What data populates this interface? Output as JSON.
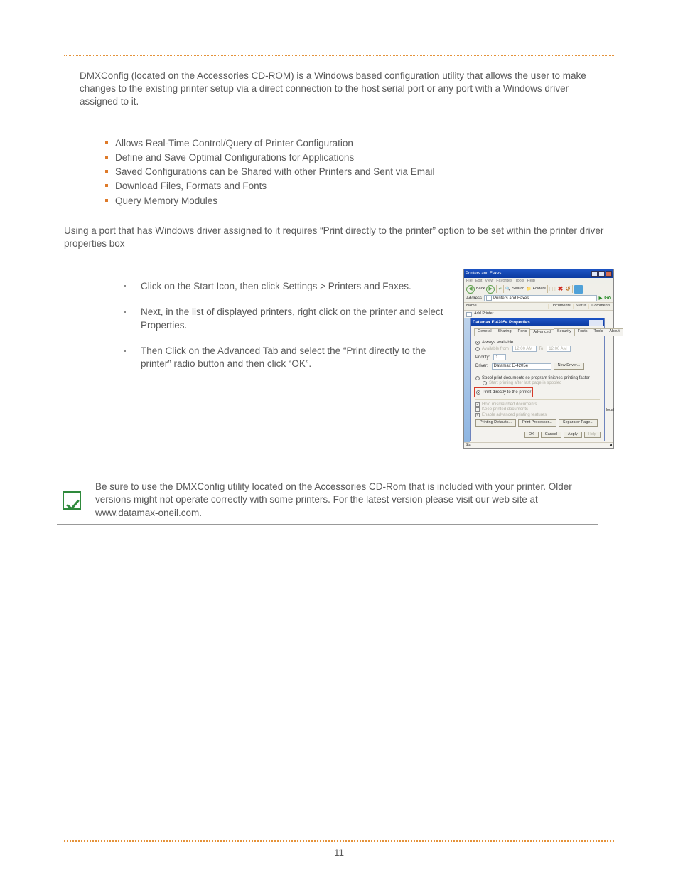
{
  "intro": "DMXConfig (located on the Accessories CD-ROM) is a Windows based configuration utility that allows the user to make changes to the existing printer setup via a direct connection to the host serial port or any port with a Windows driver assigned to it.",
  "features": [
    "Allows Real-Time Control/Query of Printer Configuration",
    "Define and Save Optimal Configurations for Applications",
    "Saved Configurations can be Shared with other Printers and Sent via Email",
    "Download Files, Formats and Fonts",
    "Query Memory Modules"
  ],
  "mid": "Using a port that has Windows driver assigned to it requires “Print directly to the printer” option to be set within the printer driver properties box",
  "steps": [
    "Click on the Start Icon, then click Settings > Printers and Faxes.",
    "Next, in the list of displayed printers, right click on the printer and select Properties.",
    "Then Click on the Advanced Tab and select the “Print directly to the printer” radio button and then click “OK”."
  ],
  "note": "Be sure to use the DMXConfig utility located on the Accessories CD-Rom that is included with your printer. Older versions might not operate correctly with some printers. For the latest version please visit our web site at www.datamax-oneil.com.",
  "page_number": "11",
  "mock": {
    "window_title": "Printers and Faxes",
    "menus": [
      "File",
      "Edit",
      "View",
      "Favorites",
      "Tools",
      "Help"
    ],
    "toolbar": {
      "back": "Back",
      "search": "Search",
      "folders": "Folders"
    },
    "address_label": "Address",
    "address_value": "Printers and Faxes",
    "go": "Go",
    "cols": {
      "name": "Name",
      "documents": "Documents",
      "status": "Status",
      "comments": "Comments"
    },
    "row1": "Add Printer",
    "rside": "nnect to local",
    "dialog": {
      "title": "Datamax E-4205e Properties",
      "tabs": [
        "General",
        "Sharing",
        "Ports",
        "Advanced",
        "Security",
        "Fonts",
        "Tools",
        "About"
      ],
      "always": "Always available",
      "avail_from": "Available from",
      "t1": "12:00 AM",
      "to": "To",
      "t2": "12:00 AM",
      "priority": "Priority:",
      "priority_v": "1",
      "driver": "Driver:",
      "driver_v": "Datamax E-4205e",
      "new_driver": "New Driver...",
      "spool": "Spool print documents so program finishes printing faster",
      "spool_sub": "Start printing after last page is spooled",
      "direct": "Print directly to the printer",
      "c1": "Hold mismatched documents",
      "c2": "Keep printed documents",
      "c3": "Enable advanced printing features",
      "b1": "Printing Defaults...",
      "b2": "Print Processor...",
      "b3": "Separator Page...",
      "ok": "OK",
      "cancel": "Cancel",
      "apply": "Apply",
      "help": "Help"
    },
    "status": "Sta"
  }
}
